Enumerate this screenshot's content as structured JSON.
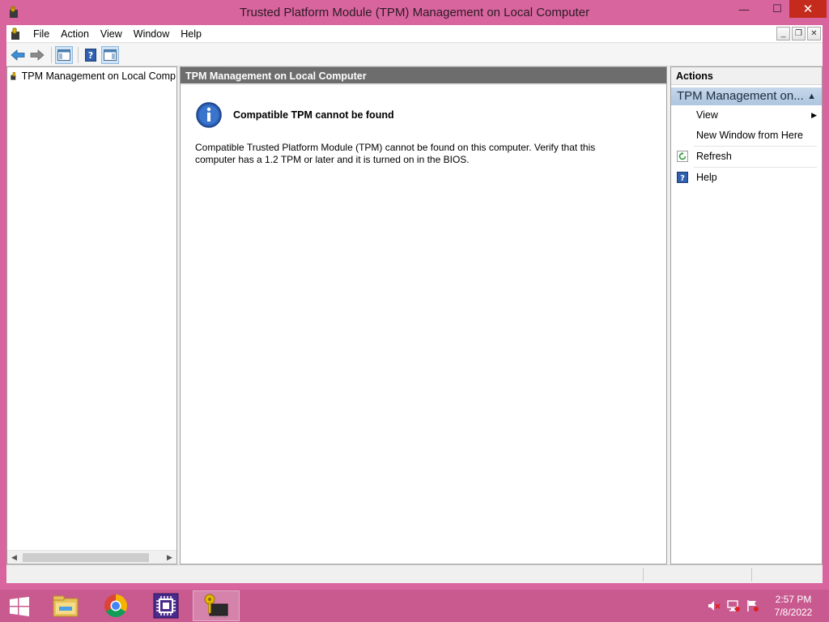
{
  "window": {
    "title": "Trusted Platform Module (TPM) Management on Local Computer",
    "min_glyph": "—",
    "max_glyph": "☐",
    "close_glyph": "✕"
  },
  "menu": {
    "items": [
      "File",
      "Action",
      "View",
      "Window",
      "Help"
    ]
  },
  "tree": {
    "root_label": "TPM Management on Local Comp"
  },
  "center": {
    "header": "TPM Management on Local Computer",
    "message_title": "Compatible TPM cannot be found",
    "message_body": "Compatible Trusted Platform Module (TPM) cannot be found on this computer. Verify that this computer has a 1.2 TPM or later and it is turned on in the BIOS."
  },
  "actions": {
    "header": "Actions",
    "group_title": "TPM Management on...",
    "items": [
      {
        "label": "View",
        "icon": "none",
        "has_submenu": true
      },
      {
        "label": "New Window from Here",
        "icon": "none",
        "has_submenu": false
      },
      {
        "label": "Refresh",
        "icon": "refresh-icon",
        "has_submenu": false
      },
      {
        "label": "Help",
        "icon": "help-icon",
        "has_submenu": false
      }
    ]
  },
  "taskbar": {
    "apps": [
      "file-explorer-icon",
      "chrome-icon",
      "cpu-app-icon",
      "tpm-console-icon"
    ],
    "active_app": "tpm-console-icon",
    "clock_time": "2:57 PM",
    "clock_date": "7/8/2022"
  },
  "colors": {
    "accent": "#d9659f",
    "taskbar": "#c95a90",
    "pane_header": "#6d6d6d",
    "actions_group": "#b7cde4"
  }
}
